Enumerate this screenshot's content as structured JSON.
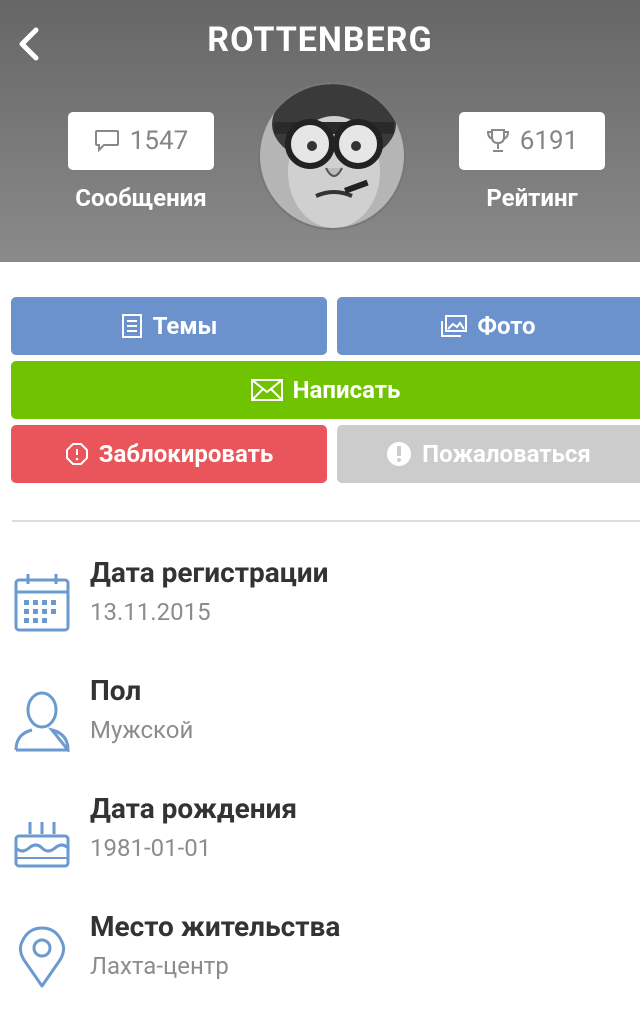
{
  "header": {
    "title": "ROTTENBERG",
    "messages": {
      "count": "1547",
      "label": "Сообщения",
      "icon": "chat-bubble-icon"
    },
    "rating": {
      "count": "6191",
      "label": "Рейтинг",
      "icon": "trophy-icon"
    }
  },
  "actions": {
    "topics": "Темы",
    "photo": "Фото",
    "write": "Написать",
    "block": "Заблокировать",
    "report": "Пожаловаться"
  },
  "info": [
    {
      "title": "Дата регистрации",
      "value": "13.11.2015",
      "icon": "calendar-icon"
    },
    {
      "title": "Пол",
      "value": "Мужской",
      "icon": "user-icon"
    },
    {
      "title": "Дата рождения",
      "value": "1981-01-01",
      "icon": "cake-icon"
    },
    {
      "title": "Место жительства",
      "value": "Лахта-центр",
      "icon": "location-pin-icon"
    }
  ],
  "colors": {
    "blue": "#6b92cc",
    "green": "#6fc300",
    "red": "#e9555b",
    "grey": "#cccccc",
    "icon_blue": "#6a9ad0"
  }
}
